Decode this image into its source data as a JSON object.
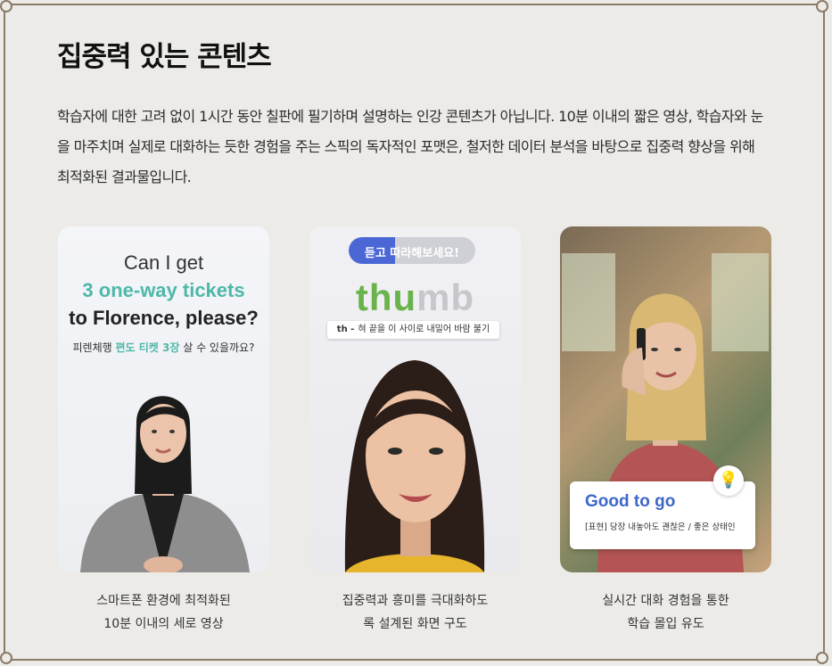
{
  "header": {
    "title": "집중력 있는 콘텐츠"
  },
  "description": "학습자에 대한 고려 없이 1시간 동안 칠판에 필기하며 설명하는 인강 콘텐츠가 아닙니다. 10분 이내의 짧은 영상, 학습자와 눈을 마주치며 실제로 대화하는 듯한 경험을 주는 스픽의 독자적인 포맷은, 철저한 데이터 분석을 바탕으로 집중력 향상을 위해 최적화된 결과물입니다.",
  "cards": [
    {
      "line1": "Can I get",
      "line2": "3 one-way tickets",
      "line3": "to Florence, please?",
      "ko_before": "피렌체행 ",
      "ko_highlight": "편도 티켓 3장",
      "ko_after": " 살 수 있을까요?",
      "caption_line1": "스마트폰 환경에 최적화된",
      "caption_line2": "10분 이내의 세로 영상"
    },
    {
      "pill": "듣고 따라해보세요!",
      "word_green": "thu",
      "word_grey": "mb",
      "hint_bold": "th -",
      "hint": "혀 끝을 이 사이로 내밀어 바람 불기",
      "caption_line1": "집중력과 흥미를 극대화하도",
      "caption_line2": "록 설계된 화면 구도"
    },
    {
      "bubble_title": "Good to go",
      "bubble_sub": "[표현] 당장 내놓아도 괜찮은 / 좋은 상태인",
      "caption_line1": "실시간 대화 경험을 통한",
      "caption_line2": "학습 몰입 유도"
    }
  ],
  "colors": {
    "accent_teal": "#4fb8a8",
    "accent_green": "#6ab34c",
    "accent_blue": "#3d67c9",
    "pill_blue": "#4b67d6",
    "background": "#ecebe8",
    "frame": "#8a7b66"
  },
  "icons": {
    "bulb": "lightbulb-icon"
  }
}
